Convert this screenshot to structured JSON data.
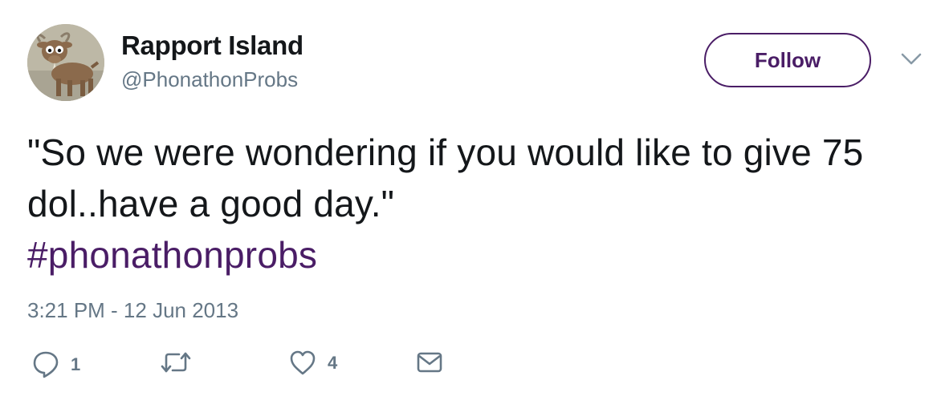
{
  "tweet": {
    "display_name": "Rapport Island",
    "handle": "@PhonathonProbs",
    "follow_label": "Follow",
    "text": "\"So we were wondering if you would like to give 75 dol..have a good day.\"",
    "hashtag": "#phonathonprobs",
    "timestamp": "3:21 PM - 12 Jun 2013",
    "reply_count": "1",
    "like_count": "4"
  },
  "icons": {
    "avatar": "goat-cartoon-avatar",
    "caret": "chevron-down-icon",
    "reply": "reply-icon",
    "retweet": "retweet-icon",
    "like": "heart-icon",
    "dm": "envelope-icon"
  },
  "colors": {
    "accent": "#4a1d66",
    "text": "#14171a",
    "muted": "#657786"
  }
}
